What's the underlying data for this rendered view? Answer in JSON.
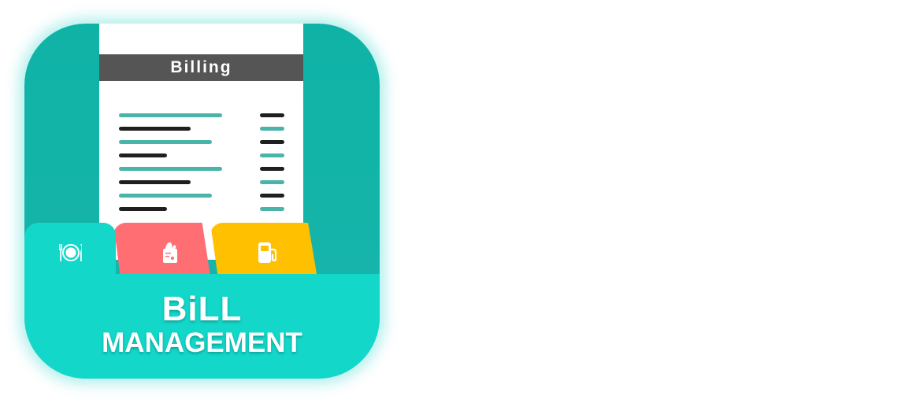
{
  "receipt": {
    "header": "Billing"
  },
  "tabs": [
    {
      "name": "food",
      "icon": "fork-plate-knife-icon",
      "color": "#12d7c9"
    },
    {
      "name": "grocery",
      "icon": "grocery-bag-icon",
      "color": "#ff6e73"
    },
    {
      "name": "fuel",
      "icon": "fuel-pump-icon",
      "color": "#ffc000"
    }
  ],
  "title": {
    "line1": "BiLL",
    "line2": "MANAGEMENT"
  },
  "colors": {
    "background": "#19b5ac",
    "folder": "#12d7c9",
    "line_teal": "#49b5aa",
    "line_dark": "#1f1f1f",
    "header": "#555555"
  }
}
